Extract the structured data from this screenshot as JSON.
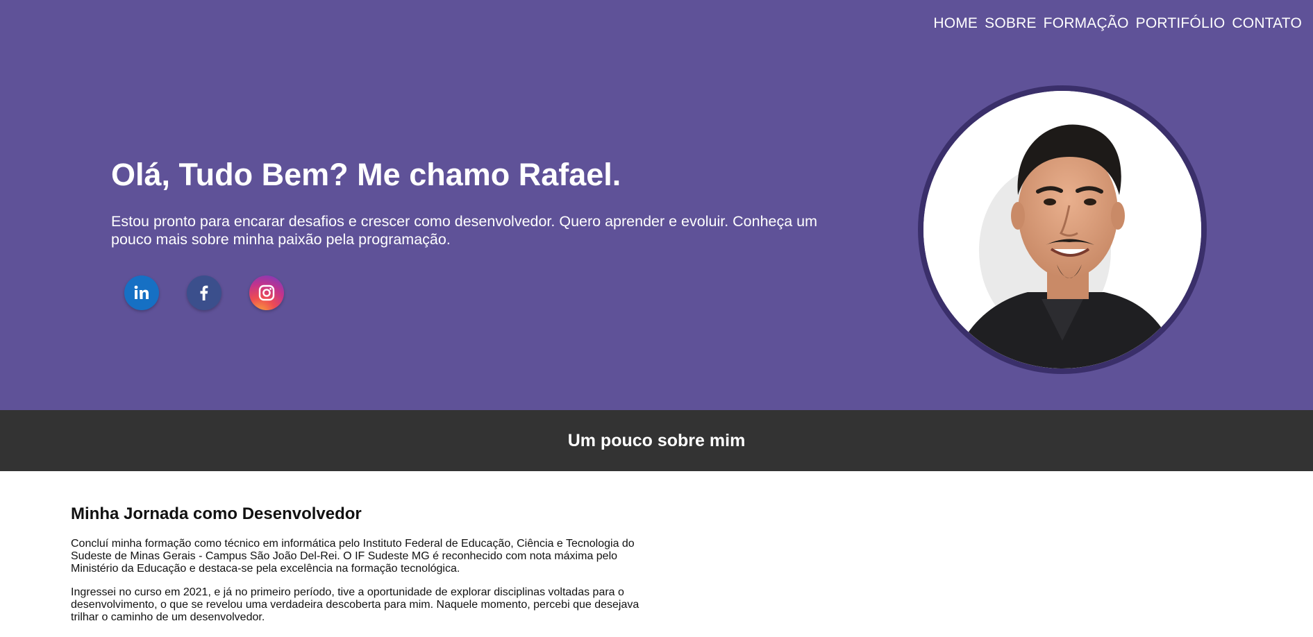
{
  "nav": {
    "items": [
      {
        "label": "HOME"
      },
      {
        "label": "SOBRE"
      },
      {
        "label": "FORMAÇÃO"
      },
      {
        "label": "PORTIFÓLIO"
      },
      {
        "label": "CONTATO"
      }
    ]
  },
  "hero": {
    "title": "Olá, Tudo Bem? Me chamo Rafael.",
    "subtitle": "Estou pronto para encarar desafios e crescer como desenvolvedor. Quero aprender e evoluir. Conheça um pouco mais sobre minha paixão pela programação.",
    "socials": [
      {
        "icon": "linkedin-icon"
      },
      {
        "icon": "facebook-icon"
      },
      {
        "icon": "instagram-icon"
      }
    ],
    "background_color": "#5f5298"
  },
  "section": {
    "title": "Um pouco sobre mim",
    "background_color": "#333333"
  },
  "about": {
    "heading": "Minha Jornada como Desenvolvedor",
    "paragraphs": [
      "Concluí minha formação como técnico em informática pelo Instituto Federal de Educação, Ciência e Tecnologia do Sudeste de Minas Gerais - Campus São João Del-Rei. O IF Sudeste MG é reconhecido com nota máxima pelo Ministério da Educação e destaca-se pela excelência na formação tecnológica.",
      "Ingressei no curso em 2021, e já no primeiro período, tive a oportunidade de explorar disciplinas voltadas para o desenvolvimento, o que se revelou uma verdadeira descoberta para mim. Naquele momento, percebi que desejava trilhar o caminho de um desenvolvedor."
    ]
  }
}
